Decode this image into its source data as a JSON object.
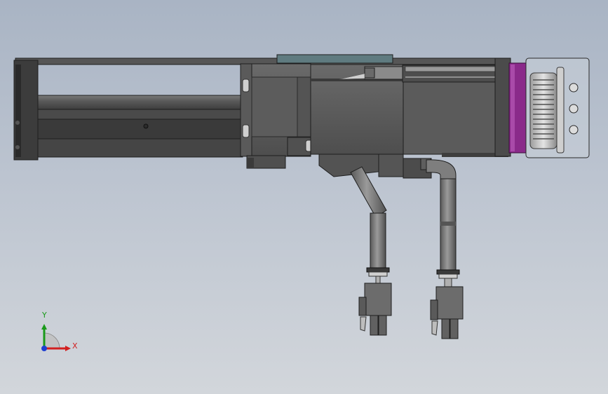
{
  "viewport": {
    "background_top": "#a9b4c4",
    "background_bottom": "#d2d6db"
  },
  "colors": {
    "body_dark": "#4a4a4a",
    "body_mid": "#5e5e5e",
    "edge": "#1e1e1e",
    "cover_teal": "#5f7b80",
    "motor_purple": "#8a2a8a",
    "pulley_light": "#d6d6d6",
    "axis_x": "#d22020",
    "axis_y": "#1a9a1a",
    "axis_z": "#1f3fd0"
  },
  "triad": {
    "x_label": "X",
    "y_label": "Y"
  }
}
